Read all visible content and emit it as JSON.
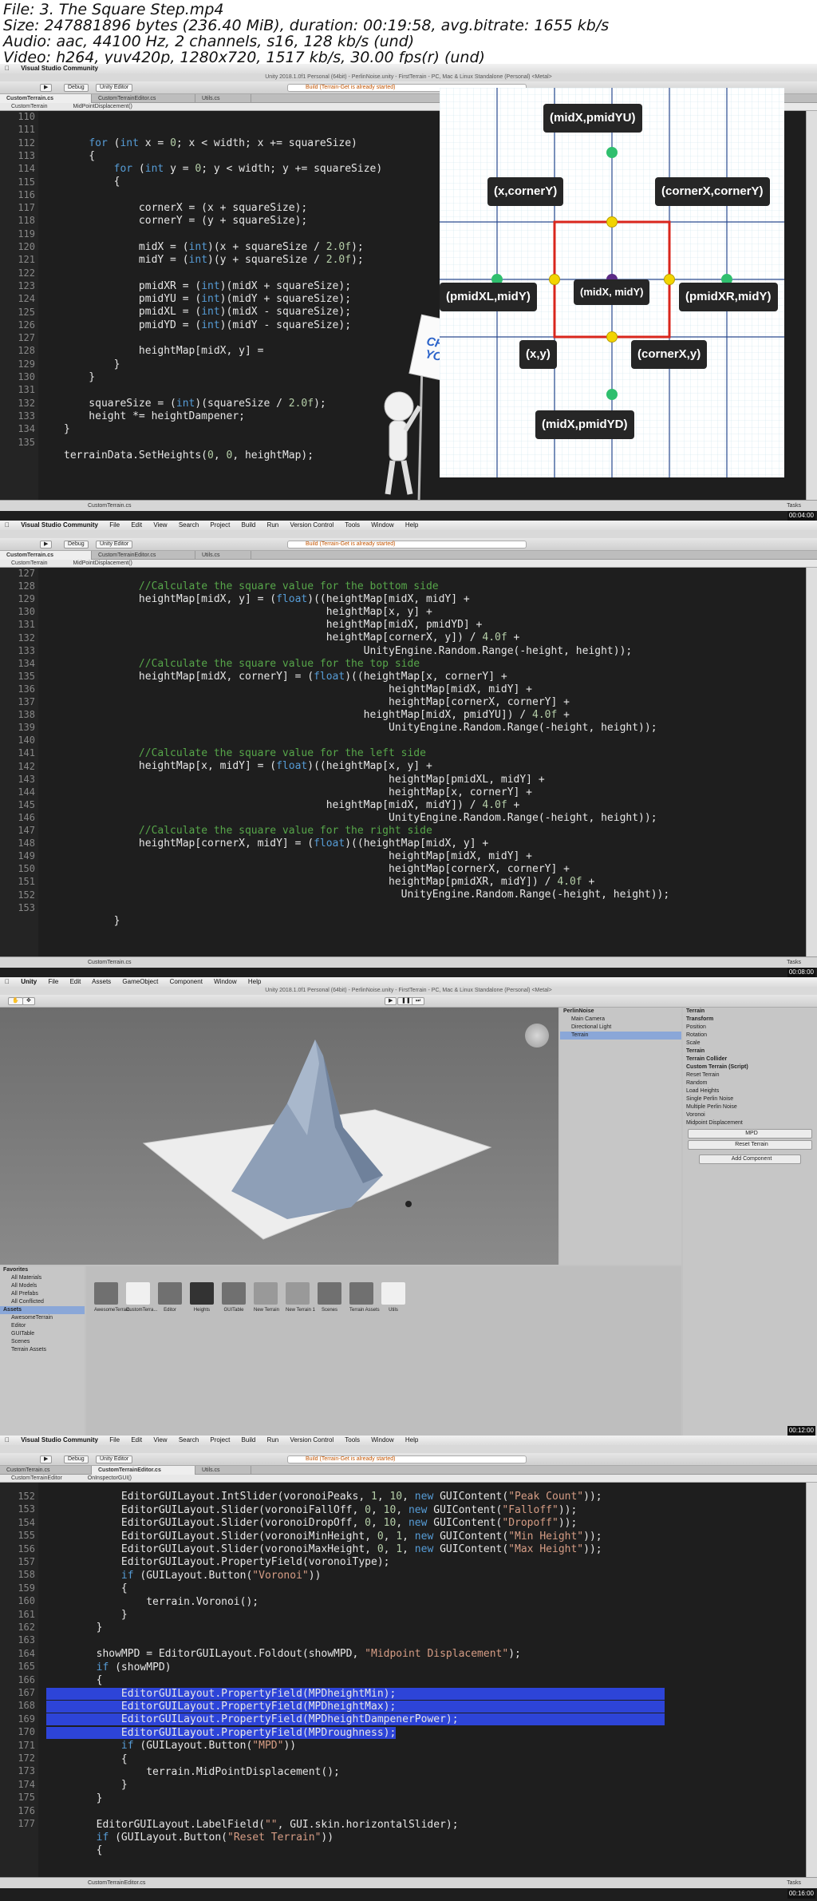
{
  "header": {
    "file": "File: 3. The Square Step.mp4",
    "size": "Size: 247881896 bytes (236.40 MiB), duration: 00:19:58, avg.bitrate: 1655 kb/s",
    "audio": "Audio: aac, 44100 Hz, 2 channels, s16, 128 kb/s (und)",
    "video": "Video: h264, yuv420p, 1280x720, 1517 kb/s, 30.00 fps(r) (und)"
  },
  "common": {
    "vs_app": "Visual Studio Community",
    "debug": "Debug",
    "unity_editor": "Unity Editor",
    "status": "Build (Terrain-Get is already started)",
    "tab_custom_terrain": "CustomTerrain.cs",
    "tab_custom_terrain_editor": "CustomTerrainEditor.cs",
    "tab_utils": "Utils.cs",
    "tasks": "Tasks",
    "menu": [
      "File",
      "Edit",
      "View",
      "Search",
      "Project",
      "Build",
      "Run",
      "Version Control",
      "Tools",
      "Window",
      "Help"
    ]
  },
  "panel1": {
    "title": "Unity 2018.1.0f1 Personal (64bit) - PerlinNoise.unity - FirstTerrain - PC, Mac & Linux Standalone (Personal) <Metal>",
    "crumb_class": "CustomTerrain",
    "crumb_method": "MidPointDisplacement()",
    "timestamp": "00:04:00",
    "line_numbers": [
      "110",
      "111",
      "112",
      "113",
      "114",
      "115",
      "116",
      "117",
      "118",
      "119",
      "120",
      "121",
      "122",
      "123",
      "124",
      "125",
      "126",
      "127",
      "128",
      "129",
      "130",
      "131",
      "132",
      "133",
      "134",
      "135"
    ],
    "challenge": "CHALLENGE YOURSELF!",
    "labels": {
      "mid_yu": "(midX,pmidYU)",
      "x_cornery": "(x,cornerY)",
      "cornerx_cornery": "(cornerX,cornerY)",
      "pmidxl": "(pmidXL,midY)",
      "mid": "(midX, midY)",
      "pmidxr": "(midX,pmidYD)",
      "pmidxr2": "(pmidXR,midY)",
      "xy": "(x,y)",
      "cornerx_y": "(cornerX,y)",
      "mid_yd": "(midX,pmidYD)"
    },
    "bottom_tab": "CustomTerrain.cs"
  },
  "panel2": {
    "crumb_class": "CustomTerrain",
    "crumb_method": "MidPointDisplacement()",
    "timestamp": "00:08:00",
    "line_numbers": [
      "127",
      "128",
      "129",
      "130",
      "131",
      "132",
      "133",
      "134",
      "135",
      "136",
      "137",
      "138",
      "139",
      "140",
      "141",
      "142",
      "143",
      "144",
      "145",
      "146",
      "147",
      "148",
      "149",
      "150",
      "151",
      "152",
      "153"
    ],
    "bottom_tab": "CustomTerrain.cs"
  },
  "panel3": {
    "title": "Unity 2018.1.0f1 Personal (64bit) - PerlinNoise.unity - FirstTerrain - PC, Mac & Linux Standalone (Personal) <Metal>",
    "menu": [
      "Unity",
      "File",
      "Edit",
      "Assets",
      "GameObject",
      "Component",
      "Window",
      "Help"
    ],
    "hierarchy": [
      "PerlinNoise",
      "Main Camera",
      "Directional Light",
      "Terrain"
    ],
    "inspector": [
      "Terrain",
      "Transform",
      "Position",
      "Rotation",
      "Scale",
      "Terrain",
      "Terrain Collider",
      "Custom Terrain (Script)",
      "Reset Terrain",
      "Random",
      "Load Heights",
      "Single Perlin Noise",
      "Multiple Perlin Noise",
      "Voronoi",
      "Midpoint Displacement"
    ],
    "btn_mpd": "MPD",
    "btn_reset": "Reset Terrain",
    "btn_add": "Add Component",
    "favorites": [
      "Favorites",
      "All Materials",
      "All Models",
      "All Prefabs",
      "All Conflicted",
      "Assets",
      "AwesomeTerrain",
      "Editor",
      "GUITable",
      "Scenes",
      "Terrain Assets"
    ],
    "assets": [
      "AwesomeTerrain",
      "CustomTerra...",
      "Editor",
      "Heights",
      "GUITable",
      "New Terrain",
      "New Terrain 1",
      "Scenes",
      "Terrain Assets",
      "Utils"
    ],
    "timestamp": "00:12:00"
  },
  "panel4": {
    "crumb_class": "CustomTerrainEditor",
    "crumb_method": "OnInspectorGUI()",
    "timestamp": "00:16:00",
    "line_numbers": [
      "152",
      "153",
      "154",
      "155",
      "156",
      "157",
      "158",
      "159",
      "160",
      "161",
      "162",
      "163",
      "164",
      "165",
      "166",
      "167",
      "168",
      "169",
      "170",
      "171",
      "172",
      "173",
      "174",
      "175",
      "176",
      "177"
    ],
    "bottom_tab": "CustomTerrainEditor.cs"
  }
}
